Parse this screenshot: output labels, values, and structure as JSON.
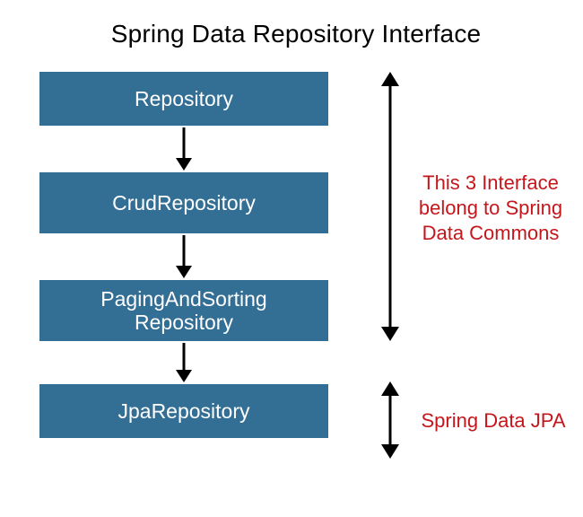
{
  "title": "Spring Data Repository Interface",
  "boxes": {
    "b1": "Repository",
    "b2": "CrudRepository",
    "b3": "PagingAndSorting Repository",
    "b4": "JpaRepository"
  },
  "annotations": {
    "a1_line1": "This 3 Interface",
    "a1_line2": "belong to Spring",
    "a1_line3": "Data Commons",
    "a2": "Spring Data JPA"
  },
  "colors": {
    "box_bg": "#336e94",
    "box_fg": "#ffffff",
    "annot": "#c4171c",
    "arrow": "#000000"
  }
}
